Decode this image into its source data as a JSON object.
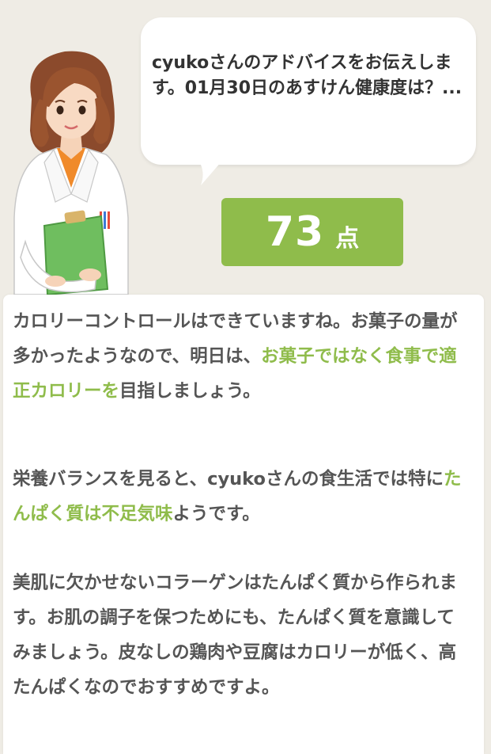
{
  "advice": {
    "bubble_text": "cyukoさんのアドバイスをお伝えします。01月30日のあすけん健康度は？...",
    "score_value": "73",
    "score_unit": "点"
  },
  "message": {
    "p1_a": "カロリーコントロールはできていますね。お菓子の量が多かったようなので、明日は、",
    "p1_highlight": "お菓子ではなく食事で適正カロリーを",
    "p1_b": "目指しましょう。",
    "p2_a": "栄養バランスを見ると、cyukoさんの食生活では特に",
    "p2_highlight": "たんぱく質は不足気味",
    "p2_b": "ようです。",
    "p3": "美肌に欠かせないコラーゲンはたんぱく質から作られます。お肌の調子を保つためにも、たんぱく質を意識してみましょう。皮なしの鶏肉や豆腐はカロリーが低く、高たんぱくなのでおすすめですよ。"
  },
  "colors": {
    "accent_green": "#8fbc4b",
    "background": "#efece5",
    "text": "#555555"
  }
}
